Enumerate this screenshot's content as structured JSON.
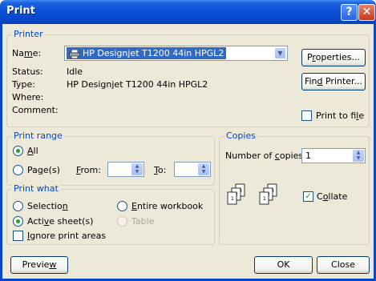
{
  "window": {
    "title": "Print",
    "help_glyph": "?",
    "close_glyph": "✕"
  },
  "printer": {
    "group_title": "Printer",
    "name_label": "Name:",
    "name_value": "HP Designjet T1200 44in HPGL2",
    "status_label": "Status:",
    "status_value": "Idle",
    "type_label": "Type:",
    "type_value": "HP Designjet T1200 44in HPGL2",
    "where_label": "Where:",
    "comment_label": "Comment:",
    "properties_button": "Properties...",
    "find_printer_button": "Find Printer...",
    "print_to_file_label": "Print to file",
    "print_to_file_checked": false
  },
  "print_range": {
    "group_title": "Print range",
    "all_label": "All",
    "pages_label": "Page(s)",
    "from_label": "From:",
    "to_label": "To:",
    "from_value": "",
    "to_value": "",
    "selected": "all"
  },
  "copies": {
    "group_title": "Copies",
    "number_label": "Number of copies:",
    "number_value": "1",
    "collate_label": "Collate",
    "collate_checked": true
  },
  "print_what": {
    "group_title": "Print what",
    "selection_label": "Selection",
    "entire_workbook_label": "Entire workbook",
    "active_sheets_label": "Active sheet(s)",
    "table_label": "Table",
    "ignore_print_areas_label": "Ignore print areas",
    "selected": "active_sheets"
  },
  "footer": {
    "preview_button": "Preview",
    "ok_button": "OK",
    "close_button": "Close"
  },
  "colors": {
    "title_bar": "#0a4fd8",
    "group_title": "#0046d5",
    "dialog_bg": "#ece9d8",
    "selection_bg": "#316ac5",
    "check_green": "#21a121"
  },
  "icons": {
    "help": "help-icon",
    "close": "close-icon",
    "printer": "printer-icon",
    "dropdown": "chevron-down-icon",
    "collate": "collate-pages-icon"
  }
}
